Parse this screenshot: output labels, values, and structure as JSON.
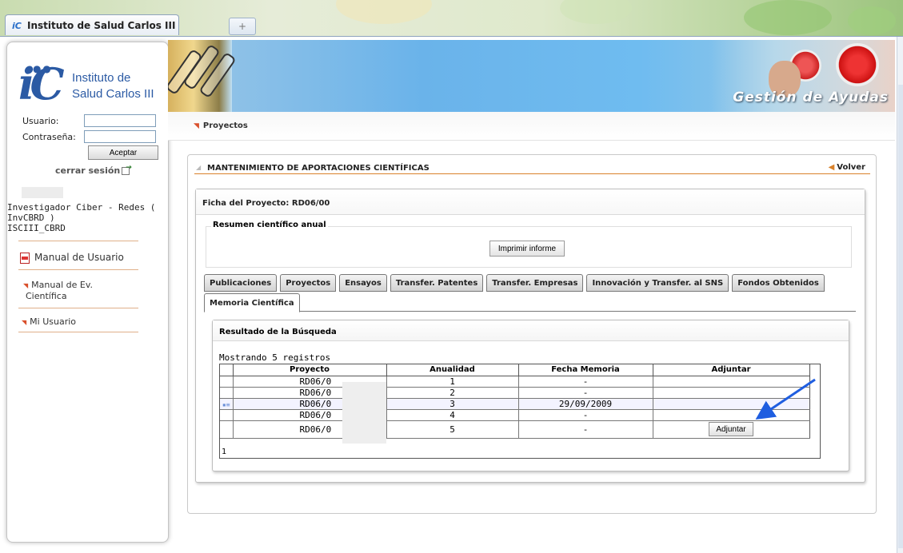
{
  "browser": {
    "tab_favicon": "iC",
    "tab_title": "Instituto de Salud Carlos III",
    "new_tab": "+"
  },
  "sidebar": {
    "logo_mark": "iC",
    "logo_line1": "Instituto de",
    "logo_line2": "Salud Carlos III",
    "usuario_label": "Usuario:",
    "contrasena_label": "Contraseña:",
    "usuario_value": "",
    "contrasena_value": "",
    "aceptar": "Aceptar",
    "cerrar_sesion": "cerrar sesión",
    "user_info_line1": "Investigador Ciber - Redes (",
    "user_info_line2": "InvCBRD )",
    "user_info_line3": "ISCIII_CBRD",
    "manual_usuario": "Manual de Usuario",
    "manual_ev_line1": "Manual de Ev.",
    "manual_ev_line2": "Científica",
    "mi_usuario": "Mi Usuario"
  },
  "banner": {
    "title": "Gestión de Ayudas"
  },
  "breadcrumb": {
    "current": "Proyectos"
  },
  "main": {
    "title": "MANTENIMIENTO DE APORTACIONES CIENTÍFICAS",
    "volver": "Volver",
    "ficha_title": "Ficha del Proyecto: RD06/00",
    "resumen_legend": "Resumen científico anual",
    "imprimir": "Imprimir informe",
    "tabs": [
      {
        "label": "Publicaciones"
      },
      {
        "label": "Proyectos"
      },
      {
        "label": "Ensayos"
      },
      {
        "label": "Transfer. Patentes"
      },
      {
        "label": "Transfer. Empresas"
      },
      {
        "label": "Innovación y Transfer. al SNS"
      },
      {
        "label": "Fondos Obtenidos"
      },
      {
        "label": "Memoria Científica"
      }
    ],
    "resultado_title": "Resultado de la Búsqueda",
    "mostrando": "Mostrando 5 registros",
    "columns": {
      "proyecto": "Proyecto",
      "anualidad": "Anualidad",
      "fecha": "Fecha Memoria",
      "adjuntar": "Adjuntar"
    },
    "rows": [
      {
        "proyecto": "RD06/0",
        "anualidad": "1",
        "fecha": "-"
      },
      {
        "proyecto": "RD06/0",
        "anualidad": "2",
        "fecha": "-"
      },
      {
        "proyecto": "RD06/0",
        "anualidad": "3",
        "fecha": "29/09/2009"
      },
      {
        "proyecto": "RD06/0",
        "anualidad": "4",
        "fecha": "-"
      },
      {
        "proyecto": "RD06/0",
        "anualidad": "5",
        "fecha": "-"
      }
    ],
    "adjuntar_button": "Adjuntar",
    "pager": "1"
  },
  "colors": {
    "accent_orange": "#d9822b",
    "arrow_blue": "#1f5ee0",
    "logo_blue": "#2b5aa4"
  }
}
